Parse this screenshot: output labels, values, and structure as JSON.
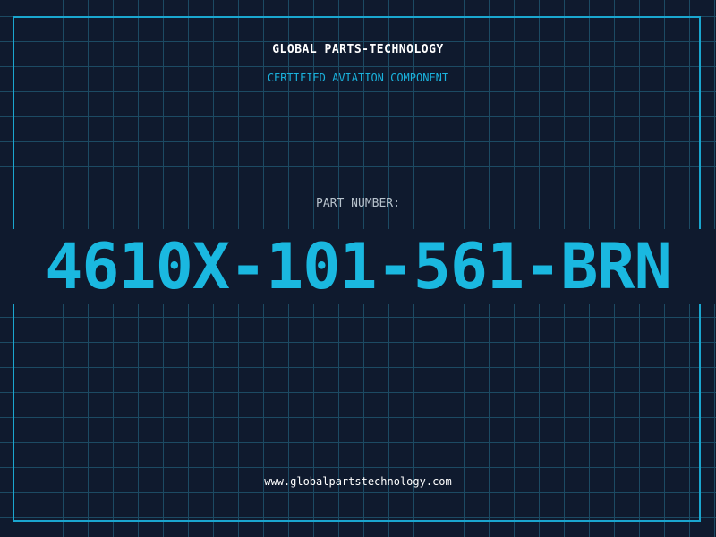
{
  "header": {
    "company_name": "GLOBAL PARTS-TECHNOLOGY",
    "subtitle": "CERTIFIED AVIATION COMPONENT"
  },
  "part": {
    "label": "PART NUMBER:",
    "number": "4610X-101-561-BRN"
  },
  "footer": {
    "website": "www.globalpartstechnology.com"
  },
  "colors": {
    "background": "#0f1a2e",
    "grid": "#1c4a63",
    "accent": "#1ab8e0",
    "frame": "#1aa6cf",
    "text": "#ffffff"
  }
}
